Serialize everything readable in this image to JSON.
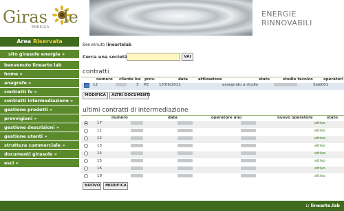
{
  "header": {
    "logo_main": "Giras",
    "logo_end": "le",
    "logo_sub": "ENERGIA",
    "tagline_line1": "ENERGIE",
    "tagline_line2": "RINNOVABILI"
  },
  "sidebar": {
    "area_prefix": "Area ",
    "area_highlight": "Riservata",
    "items": [
      {
        "label": "sito girasole energia »"
      },
      {
        "label": "benvenuto linearte lab"
      },
      {
        "label": "home »"
      },
      {
        "label": "anagrafe »"
      },
      {
        "label": "contratti fv »"
      },
      {
        "label": "contratti intermediazione »"
      },
      {
        "label": "gestione prodotti »"
      },
      {
        "label": "provvigioni »"
      },
      {
        "label": "gestione descrizioni »"
      },
      {
        "label": "gestione utenti »"
      },
      {
        "label": "struttura commerciale »"
      },
      {
        "label": "documenti girasole »"
      },
      {
        "label": "esci »"
      }
    ]
  },
  "main": {
    "welcome_prefix": "Benvenuto ",
    "welcome_user": "lineartelab",
    "search_label": "Cerca una società:",
    "search_value": "",
    "go_label": "VAI",
    "contratti": {
      "title": "contratti",
      "headers": {
        "numero": "numero",
        "cliente": "cliente",
        "kw": "kw",
        "prov": "prov.",
        "data": "data",
        "attivazione": "attivazione",
        "stato": "stato",
        "studio_tecnico": "studio tecnico",
        "operatori": "operatori"
      },
      "row": {
        "numero": "12",
        "kw": "3",
        "prov": "PZ",
        "data": "15/09/2011",
        "stato": "assegnato a studio",
        "operatori": "Sale001"
      },
      "btn_modifica": "MODIFICA",
      "btn_altri": "ALTRI DOCUMENTI"
    },
    "intermediazione": {
      "title": "ultimi contratti di intermediazione",
      "headers": {
        "numero": "numero",
        "data": "data",
        "operatore_uno": "operatore uno",
        "nuovo_operatore": "nuovo operatore",
        "stato": "stato"
      },
      "rows": [
        {
          "numero": "17",
          "stato": "attivo"
        },
        {
          "numero": "11",
          "stato": "attivo"
        },
        {
          "numero": "12",
          "stato": "attivo"
        },
        {
          "numero": "13",
          "stato": "attivo"
        },
        {
          "numero": "14",
          "stato": "attivo"
        },
        {
          "numero": "15",
          "stato": "attivo"
        },
        {
          "numero": "16",
          "stato": "attivo"
        },
        {
          "numero": "18",
          "stato": "attivo"
        }
      ],
      "btn_nuovo": "NUOVO",
      "btn_modifica": "MODIFICA"
    }
  },
  "footer": {
    "text": ":: linearte.lab"
  },
  "colors": {
    "nav_green": "#5b8a2c",
    "dark_green": "#3f6b1e",
    "highlight_yellow": "#f5d13a",
    "search_bg": "#fdf7c4"
  }
}
